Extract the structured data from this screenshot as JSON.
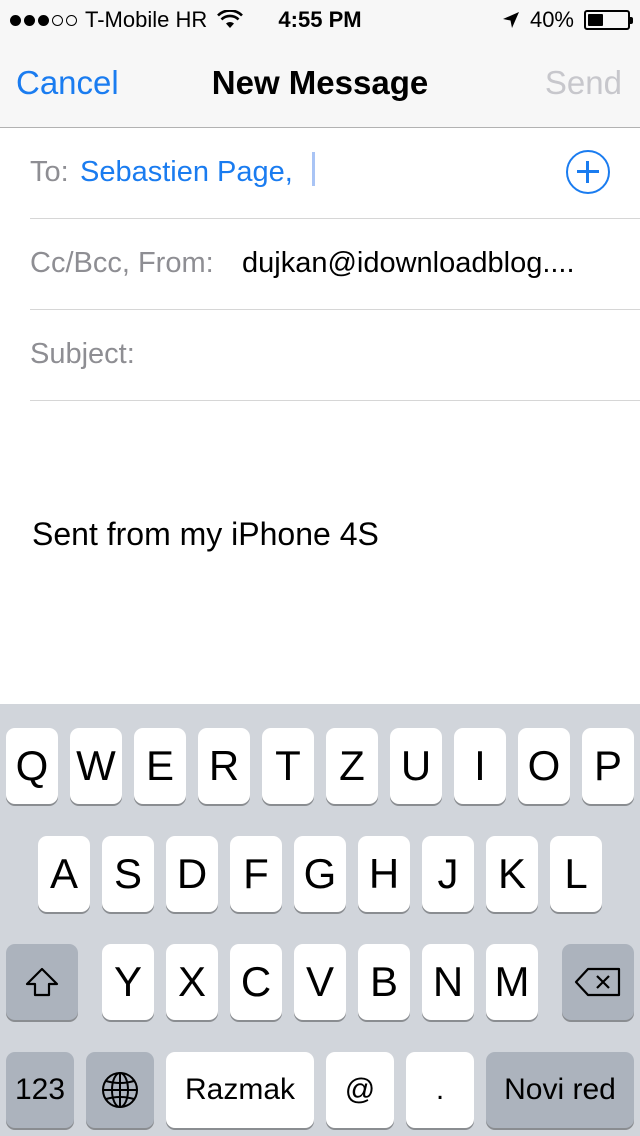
{
  "status_bar": {
    "carrier": "T-Mobile HR",
    "time": "4:55 PM",
    "battery_percent": "40%",
    "battery_level": 0.4,
    "signal_dots_filled": 3,
    "signal_dots_total": 5
  },
  "nav": {
    "cancel_label": "Cancel",
    "title": "New Message",
    "send_label": "Send"
  },
  "compose": {
    "to_label": "To:",
    "to_value": "Sebastien Page,",
    "cc_label": "Cc/Bcc, From:",
    "from_value": "dujkan@idownloadblog....",
    "subject_label": "Subject:",
    "subject_value": "",
    "body": "Sent from my iPhone 4S"
  },
  "keyboard": {
    "row1": [
      "Q",
      "W",
      "E",
      "R",
      "T",
      "Z",
      "U",
      "I",
      "O",
      "P"
    ],
    "row2": [
      "A",
      "S",
      "D",
      "F",
      "G",
      "H",
      "J",
      "K",
      "L"
    ],
    "row3": [
      "Y",
      "X",
      "C",
      "V",
      "B",
      "N",
      "M"
    ],
    "numbers_label": "123",
    "space_label": "Razmak",
    "at_label": "@",
    "dot_label": ".",
    "return_label": "Novi red"
  },
  "colors": {
    "accent": "#1a7cf0",
    "disabled": "#c7c7cc",
    "label_gray": "#8e8e93",
    "keyboard_bg": "#d1d5db"
  }
}
